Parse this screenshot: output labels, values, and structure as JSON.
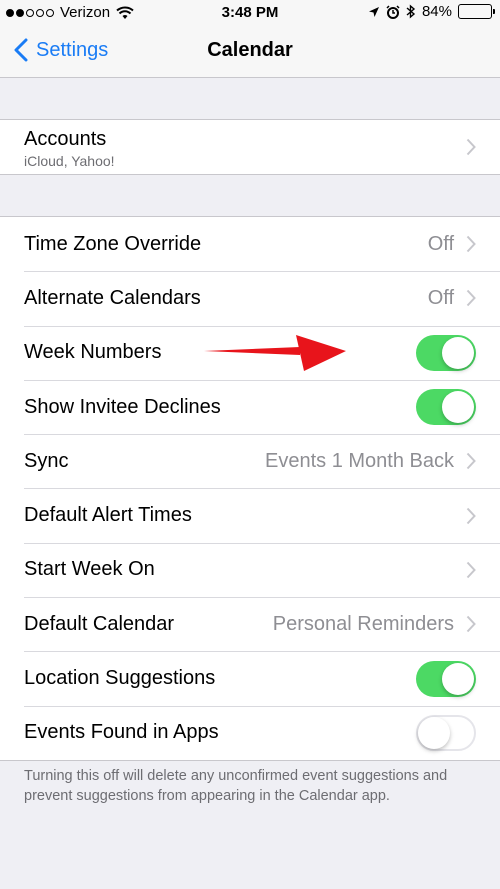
{
  "status_bar": {
    "carrier": "Verizon",
    "time": "3:48 PM",
    "battery": "84%",
    "battery_level": 0.84,
    "icons": [
      "signal-dots-icon",
      "wifi-icon",
      "location-icon",
      "alarm-icon",
      "bluetooth-icon",
      "battery-icon"
    ]
  },
  "nav": {
    "back_label": "Settings",
    "title": "Calendar"
  },
  "accounts": {
    "title": "Accounts",
    "subtitle": "iCloud, Yahoo!"
  },
  "settings": [
    {
      "label": "Time Zone Override",
      "value": "Off",
      "type": "link"
    },
    {
      "label": "Alternate Calendars",
      "value": "Off",
      "type": "link"
    },
    {
      "label": "Week Numbers",
      "type": "toggle",
      "on": true
    },
    {
      "label": "Show Invitee Declines",
      "type": "toggle",
      "on": true
    },
    {
      "label": "Sync",
      "value": "Events 1 Month Back",
      "type": "link"
    },
    {
      "label": "Default Alert Times",
      "value": "",
      "type": "link"
    },
    {
      "label": "Start Week On",
      "value": "",
      "type": "link"
    },
    {
      "label": "Default Calendar",
      "value": "Personal Reminders",
      "type": "link"
    },
    {
      "label": "Location Suggestions",
      "type": "toggle",
      "on": true
    },
    {
      "label": "Events Found in Apps",
      "type": "toggle",
      "on": false
    }
  ],
  "footer_note": "Turning this off will delete any unconfirmed event suggestions and prevent suggestions from appearing in the Calendar app.",
  "colors": {
    "accent": "#1a7cf5",
    "toggle_on": "#4cd964",
    "annotation_arrow": "#e8141b",
    "background": "#efeff4"
  }
}
